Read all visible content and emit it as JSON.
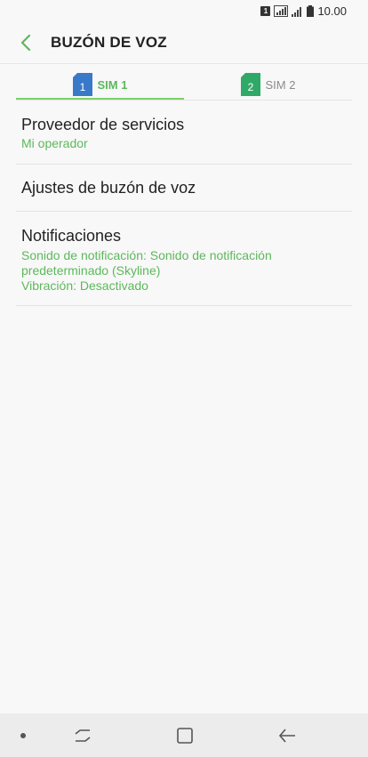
{
  "status_bar": {
    "sim_indicator": "1",
    "time": "10.00"
  },
  "header": {
    "title": "BUZÓN DE VOZ",
    "back_icon": "chevron-left-icon"
  },
  "tabs": [
    {
      "label": "SIM 1",
      "sim_number": "1",
      "sim_color": "#3a79c8",
      "selected": true
    },
    {
      "label": "SIM 2",
      "sim_number": "2",
      "sim_color": "#2fa968",
      "selected": false
    }
  ],
  "settings": {
    "provider": {
      "title": "Proveedor de servicios",
      "value": "Mi operador"
    },
    "voicemail_settings": {
      "title": "Ajustes de buzón de voz"
    },
    "notifications": {
      "title": "Notificaciones",
      "sound_line1": "Sonido de notificación: Sonido de notificación",
      "sound_line2": "predeterminado (Skyline)",
      "vibration": "Vibración: Desactivado"
    }
  },
  "colors": {
    "accent": "#5cb85c",
    "tab_underline": "#7fcf6c"
  },
  "nav_icons": [
    "recents-icon",
    "home-icon",
    "back-icon"
  ]
}
